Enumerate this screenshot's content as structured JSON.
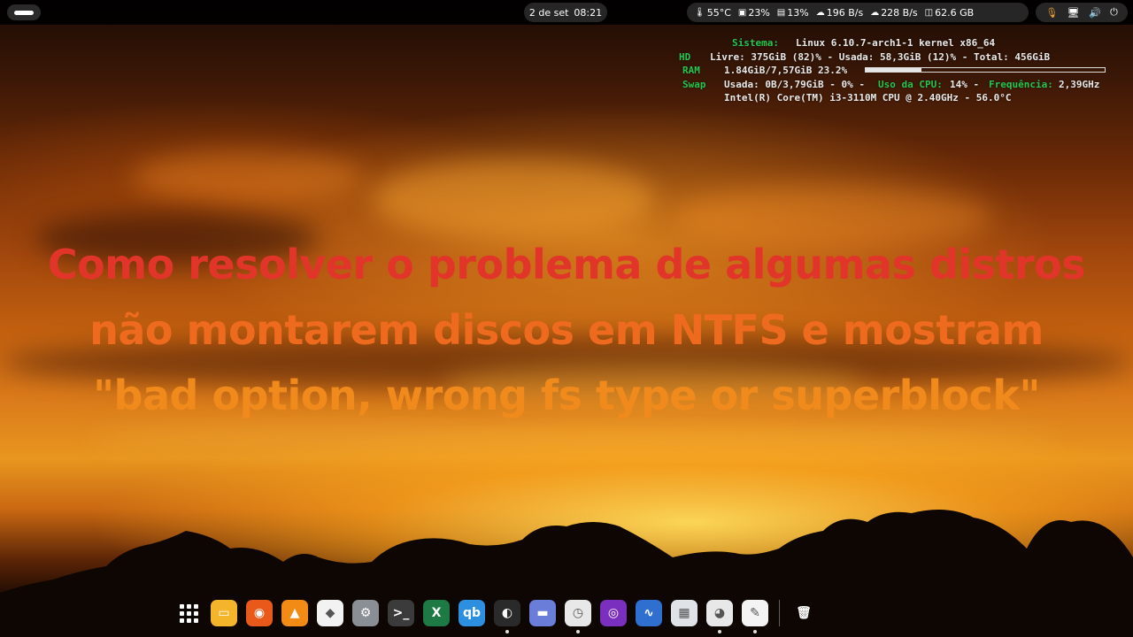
{
  "topbar": {
    "date": "2 de set",
    "time": "08:21",
    "status_items": [
      {
        "icon": "thermometer-icon",
        "glyph": "🌡",
        "text": "55°C"
      },
      {
        "icon": "cpu-icon",
        "glyph": "▣",
        "text": "23%"
      },
      {
        "icon": "memory-icon",
        "glyph": "▤",
        "text": "13%"
      },
      {
        "icon": "download-icon",
        "glyph": "☁",
        "text": "196 B/s"
      },
      {
        "icon": "upload-icon",
        "glyph": "☁",
        "text": "228 B/s"
      },
      {
        "icon": "disk-icon",
        "glyph": "◫",
        "text": "62.6 GB"
      }
    ],
    "system_icons": [
      "microphone-icon",
      "network-icon",
      "volume-icon",
      "power-icon"
    ]
  },
  "conky": {
    "sistema_label": "Sistema:",
    "sistema_value": "Linux 6.10.7-arch1-1 kernel x86_64",
    "hd_label": "HD",
    "hd_value": "Livre: 375GiB (82)% - Usada: 58,3GiB (12)% - Total: 456GiB",
    "ram_label": "RAM",
    "ram_value": "1.84GiB/7,57GiB 23.2%",
    "ram_fraction": 0.232,
    "swap_label": "Swap",
    "swap_value": "Usada: 0B/3,79GiB - 0%  -",
    "cpu_label": "Uso da CPU:",
    "cpu_value": "14% -",
    "freq_label": "Frequência:",
    "freq_value": "2,39GHz",
    "cpu_model": "Intel(R) Core(TM) i3-3110M CPU @ 2.40GHz - 56.0°C"
  },
  "headline": {
    "line1": "Como resolver o problema de algumas distros",
    "line2": "não montarem discos em NTFS e mostram",
    "line3": "\"bad option, wrong fs type or superblock\""
  },
  "dock": {
    "apps": [
      {
        "name": "app-grid-icon",
        "color": "transparent",
        "glyph": "",
        "running": false
      },
      {
        "name": "files-icon",
        "color": "#f5b52a",
        "glyph": "▭",
        "running": false
      },
      {
        "name": "firefox-icon",
        "color": "#e8591a",
        "glyph": "◉",
        "running": false
      },
      {
        "name": "vlc-icon",
        "color": "#f28a16",
        "glyph": "▲",
        "running": false
      },
      {
        "name": "software-store-icon",
        "color": "#f2f2f2",
        "glyph": "◆",
        "running": false
      },
      {
        "name": "settings-icon",
        "color": "#8a8f96",
        "glyph": "⚙",
        "running": false
      },
      {
        "name": "terminal-icon",
        "color": "#3b3b3b",
        "glyph": ">_",
        "running": false
      },
      {
        "name": "excel-icon",
        "color": "#1e7a45",
        "glyph": "X",
        "running": false
      },
      {
        "name": "qbittorrent-icon",
        "color": "#2d8fe0",
        "glyph": "qb",
        "running": false
      },
      {
        "name": "obs-icon",
        "color": "#2a2a2a",
        "glyph": "◐",
        "running": true
      },
      {
        "name": "disks-icon",
        "color": "#6a7dd8",
        "glyph": "▬",
        "running": false
      },
      {
        "name": "system-monitor-recorder-icon",
        "color": "#e8e8e8",
        "glyph": "◷",
        "running": true
      },
      {
        "name": "tor-browser-icon",
        "color": "#7b2fbf",
        "glyph": "◎",
        "running": false
      },
      {
        "name": "activity-monitor-icon",
        "color": "#2f6fd0",
        "glyph": "∿",
        "running": false
      },
      {
        "name": "calculator-icon",
        "color": "#dfe3e8",
        "glyph": "▦",
        "running": false
      },
      {
        "name": "chrome-icon",
        "color": "#e8e8e8",
        "glyph": "◕",
        "running": true
      },
      {
        "name": "text-editor-icon",
        "color": "#f4f4f4",
        "glyph": "✎",
        "running": true
      },
      {
        "name": "trash-icon",
        "color": "transparent",
        "glyph": "🗑",
        "running": false
      }
    ]
  }
}
